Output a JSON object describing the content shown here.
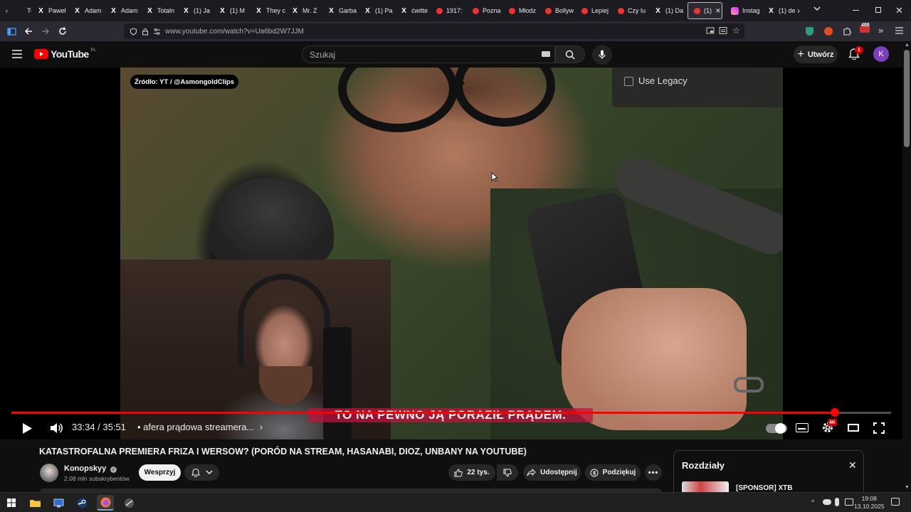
{
  "browser": {
    "tabs": [
      {
        "title": "Tu",
        "icon": "back-chevron"
      },
      {
        "title": "Paweł",
        "icon": "x-logo"
      },
      {
        "title": "Adam",
        "icon": "x-logo"
      },
      {
        "title": "Adam",
        "icon": "x-logo"
      },
      {
        "title": "Totaln",
        "icon": "x-logo"
      },
      {
        "title": "(1) Ja",
        "icon": "x-logo"
      },
      {
        "title": "(1) M",
        "icon": "x-logo"
      },
      {
        "title": "They c",
        "icon": "x-logo"
      },
      {
        "title": "Mr. Z",
        "icon": "x-logo"
      },
      {
        "title": "Garba",
        "icon": "x-logo"
      },
      {
        "title": "(1) Pa",
        "icon": "x-logo"
      },
      {
        "title": "ćwitte",
        "icon": "x-logo"
      },
      {
        "title": "1917:",
        "icon": "youtube-icon"
      },
      {
        "title": "Pozna",
        "icon": "youtube-icon"
      },
      {
        "title": "Młodz",
        "icon": "youtube-icon"
      },
      {
        "title": "Bollyw",
        "icon": "youtube-icon"
      },
      {
        "title": "Lepiej",
        "icon": "youtube-icon"
      },
      {
        "title": "Czy lu",
        "icon": "youtube-icon"
      },
      {
        "title": "(1) Da",
        "icon": "x-logo"
      },
      {
        "title": "(1)",
        "icon": "youtube-icon",
        "active": true
      },
      {
        "title": "Instag",
        "icon": "instagram-icon"
      },
      {
        "title": "(1) de",
        "icon": "x-logo"
      }
    ],
    "url": "www.youtube.com/watch?v=Ua6bd2W7JJM",
    "extension_badge": "488"
  },
  "youtube": {
    "logo_text": "YouTube",
    "logo_region": "PL",
    "search_placeholder": "Szukaj",
    "create_label": "Utwórz",
    "notification_count": "1",
    "account_initial": "K"
  },
  "player": {
    "source_badge": "Źródło: YT / @AsmongoldClips",
    "legacy_label": "Use Legacy",
    "subtitle": "TO NA PEWNO JĄ PORAZIŁ PRĄDEM.",
    "time_current": "33:34",
    "time_total": "35:51",
    "time_display": "33:34 / 35:51",
    "chapter_link": "• afera prądowa streamera...",
    "progress": 0.936,
    "quality_badge": "4K",
    "accent_color": "#ff0000"
  },
  "video": {
    "title": "KATASTROFALNA PREMIERA FRIZA I WERSOW? (PORÓD NA STREAM, HASANABI, DIOZ, UNBANY NA YOUTUBE)",
    "channel_name": "Konopskyy",
    "subscribers": "2,08 mln subskrybentów",
    "support_label": "Wesprzyj",
    "likes": "22 tys.",
    "share_label": "Udostępnij",
    "thanks_label": "Podziękuj"
  },
  "chapters": {
    "title": "Rozdziały",
    "items": [
      {
        "label": "[SPONSOR] XTB"
      }
    ]
  },
  "taskbar": {
    "time": "19:08",
    "date": "13.10.2025"
  }
}
